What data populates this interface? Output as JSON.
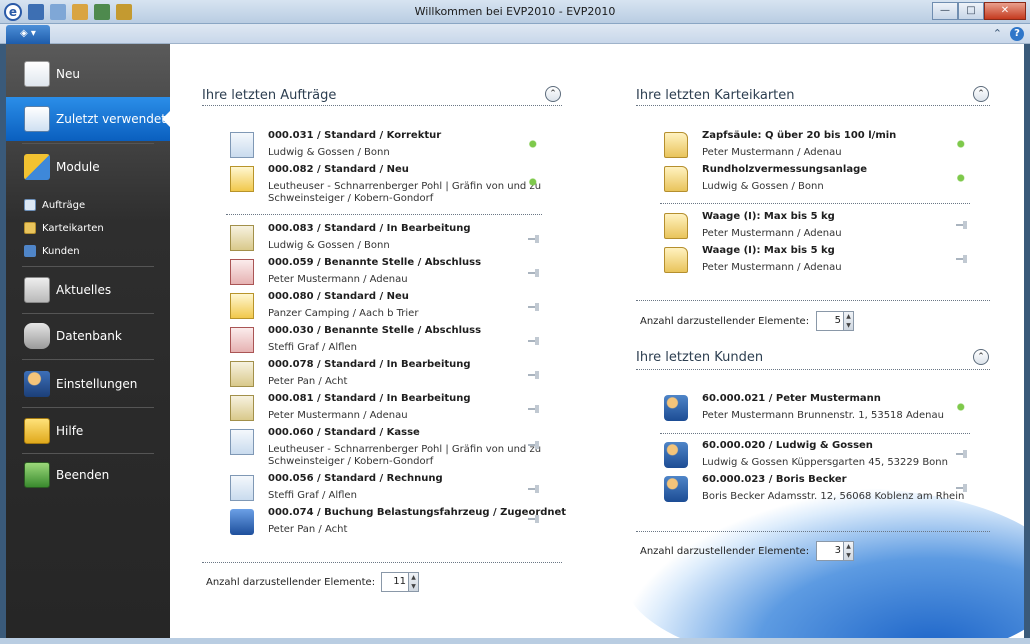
{
  "window": {
    "title": "Willkommen bei EVP2010 - EVP2010"
  },
  "sidebar": {
    "nav": [
      {
        "label": "Neu"
      },
      {
        "label": "Zuletzt verwendet"
      },
      {
        "label": "Module"
      },
      {
        "label": "Aktuelles"
      },
      {
        "label": "Datenbank"
      },
      {
        "label": "Einstellungen"
      },
      {
        "label": "Hilfe"
      },
      {
        "label": "Beenden"
      }
    ],
    "modules": [
      {
        "label": "Aufträge"
      },
      {
        "label": "Karteikarten"
      },
      {
        "label": "Kunden"
      }
    ]
  },
  "orders": {
    "title": "Ihre letzten Aufträge",
    "count_label": "Anzahl darzustellender Elemente:",
    "count_value": "11",
    "items": [
      {
        "title": "000.031 / Standard / Korrektur",
        "sub": "Ludwig & Gossen / Bonn",
        "sub2": "",
        "pinned": true
      },
      {
        "title": "000.082 / Standard / Neu",
        "sub": "Leutheuser - Schnarrenberger Pohl | Gräfin von und zu",
        "sub2": "Schweinsteiger / Kobern-Gondorf",
        "pinned": true
      },
      {
        "title": "000.083 / Standard / In Bearbeitung",
        "sub": "Ludwig & Gossen / Bonn",
        "sub2": "",
        "pinned": false
      },
      {
        "title": "000.059 / Benannte Stelle / Abschluss",
        "sub": "Peter Mustermann / Adenau",
        "sub2": "",
        "pinned": false
      },
      {
        "title": "000.080 / Standard / Neu",
        "sub": "Panzer Camping / Aach b Trier",
        "sub2": "",
        "pinned": false
      },
      {
        "title": "000.030 / Benannte Stelle / Abschluss",
        "sub": "Steffi Graf / Alflen",
        "sub2": "",
        "pinned": false
      },
      {
        "title": "000.078 / Standard / In Bearbeitung",
        "sub": "Peter Pan / Acht",
        "sub2": "",
        "pinned": false
      },
      {
        "title": "000.081 / Standard / In Bearbeitung",
        "sub": "Peter Mustermann / Adenau",
        "sub2": "",
        "pinned": false
      },
      {
        "title": "000.060 / Standard / Kasse",
        "sub": "Leutheuser - Schnarrenberger Pohl | Gräfin von und zu",
        "sub2": "Schweinsteiger / Kobern-Gondorf",
        "pinned": false
      },
      {
        "title": "000.056 / Standard / Rechnung",
        "sub": "Steffi Graf / Alflen",
        "sub2": "",
        "pinned": false
      },
      {
        "title": "000.074 / Buchung Belastungsfahrzeug / Zugeordnet",
        "sub": "Peter Pan / Acht",
        "sub2": "",
        "pinned": false
      }
    ]
  },
  "cards": {
    "title": "Ihre letzten Karteikarten",
    "count_label": "Anzahl darzustellender Elemente:",
    "count_value": "5",
    "items": [
      {
        "title": "Zapfsäule: Q über 20 bis 100 l/min",
        "sub": "Peter Mustermann / Adenau",
        "pinned": true
      },
      {
        "title": "Rundholzvermessungsanlage",
        "sub": "Ludwig & Gossen / Bonn",
        "pinned": true
      },
      {
        "title": "Waage (I): Max bis 5 kg",
        "sub": "Peter Mustermann / Adenau",
        "pinned": false
      },
      {
        "title": "Waage (I): Max bis 5 kg",
        "sub": "Peter Mustermann / Adenau",
        "pinned": false
      }
    ]
  },
  "customers": {
    "title": "Ihre letzten Kunden",
    "count_label": "Anzahl darzustellender Elemente:",
    "count_value": "3",
    "items": [
      {
        "title": "60.000.021 / Peter Mustermann",
        "sub": "Peter Mustermann Brunnenstr. 1, 53518 Adenau",
        "pinned": true
      },
      {
        "title": "60.000.020 / Ludwig & Gossen",
        "sub": "Ludwig & Gossen Küppersgarten 45, 53229 Bonn",
        "pinned": false
      },
      {
        "title": "60.000.023 / Boris Becker",
        "sub": "Boris Becker Adamsstr. 12, 56068 Koblenz am Rhein",
        "pinned": false
      }
    ]
  }
}
